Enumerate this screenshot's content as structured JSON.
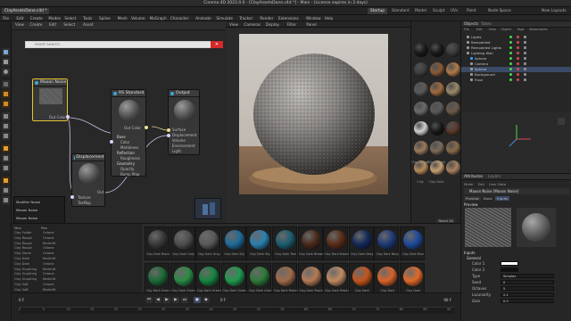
{
  "app": {
    "title": "Cinema 4D 2023.0.0 - [ClayAssetsDone.c4d *] - Main - (License expires in 3 days)"
  },
  "layout_tabs": [
    "Startup",
    "Standard",
    "Model",
    "Sculpt",
    "UVs",
    "Paint",
    "Node Space"
  ],
  "layout_tabs_right": "New Layouts",
  "doc_tab": "ClayAssetsDone.c4d *",
  "menubar": [
    "File",
    "Edit",
    "Create",
    "Modes",
    "Select",
    "Tools",
    "Spline",
    "Mesh",
    "Volume",
    "MoGraph",
    "Character",
    "Animate",
    "Simulate",
    "Tracker",
    "Render",
    "Extensions",
    "Window",
    "Help"
  ],
  "node_editor": {
    "menu": [
      "View",
      "Create",
      "Edit",
      "Select",
      "Asset"
    ],
    "search_placeholder": "Asset Search...",
    "nodes": {
      "maxon_noise": {
        "title": "Maxon Noise",
        "port": "Out Color"
      },
      "rs_standard": {
        "title": "RS Standard",
        "port": "Out Color",
        "groups": [
          {
            "name": "Base",
            "items": [
              "Color",
              "Metalness"
            ]
          },
          {
            "name": "Reflection",
            "items": [
              "Roughness"
            ]
          },
          {
            "name": "Geometry",
            "items": [
              "Opacity",
              "Bump Map"
            ]
          }
        ]
      },
      "output": {
        "title": "Output",
        "ports": [
          "Surface",
          "Displacement",
          "Volume",
          "Environment",
          "Light"
        ]
      },
      "displacement": {
        "title": "Displacement",
        "ports": [
          "Texture",
          "TexMap"
        ],
        "out": "Out"
      }
    }
  },
  "popup_menu": {
    "items": [
      "Modifier Noise",
      "Maxon Noise",
      "Maxon Noise"
    ]
  },
  "viewport": {
    "menu": [
      "View",
      "Cameras",
      "Display",
      "Filter",
      "Panel"
    ]
  },
  "material_panel": {
    "labels": [
      "Clay Rough",
      "Clay Rough",
      "Clay",
      "Clay Dark"
    ]
  },
  "objects": {
    "tabs": [
      "Objects",
      "Takes"
    ],
    "menu": [
      "File",
      "Edit",
      "View",
      "Object",
      "Tags",
      "Bookmarks"
    ],
    "rows": [
      {
        "name": "Lights",
        "color": "#9a9a9a"
      },
      {
        "name": "Remodeled",
        "color": "#9a9a9a"
      },
      {
        "name": "Remodeled Lights",
        "color": "#9a9a9a"
      },
      {
        "name": "Lighting Wall",
        "color": "#9a9a9a"
      },
      {
        "name": "Sphere",
        "color": "#2f9cff"
      },
      {
        "name": "Camera",
        "color": "#9a9a9a"
      },
      {
        "name": "Sphere",
        "color": "#9a9a9a",
        "selected": true
      },
      {
        "name": "Background",
        "color": "#9a9a9a"
      },
      {
        "name": "Floor",
        "color": "#9a9a9a"
      }
    ]
  },
  "attributes": {
    "tabs": [
      "Attributes",
      "Layers"
    ],
    "menu": [
      "Mode",
      "Edit",
      "User Data"
    ],
    "node_name": "Maxon Noise [Maxon Noise]",
    "subtabs": [
      "Preview",
      "Basic",
      "Inputs"
    ],
    "preview_label": "Preview",
    "inputs_label": "Inputs",
    "general_label": "General",
    "fields": [
      {
        "label": "Color 1",
        "value": ""
      },
      {
        "label": "Color 2",
        "value": ""
      },
      {
        "label": "Type",
        "value": "Simplex"
      },
      {
        "label": "Seed",
        "value": "0"
      },
      {
        "label": "Octaves",
        "value": "5"
      },
      {
        "label": "Lacunarity",
        "value": "2.1"
      },
      {
        "label": "Gain",
        "value": "0.5"
      }
    ]
  },
  "asset_browser": {
    "refresh_label": "Reset All",
    "row1": [
      {
        "label": "Clay Dark Black",
        "color": "#3a3a3a"
      },
      {
        "label": "Clay Dark Gray",
        "color": "#4e4e4e"
      },
      {
        "label": "Clay Dark Gray",
        "color": "#5a5a5a"
      },
      {
        "label": "Clay Dark Sky",
        "color": "#1f6b9a"
      },
      {
        "label": "Clay Dark Sky",
        "color": "#2a80b0"
      },
      {
        "label": "Clay Dark Teal",
        "color": "#1c5d70"
      },
      {
        "label": "Clay Dark Brown",
        "color": "#4a2a1c"
      },
      {
        "label": "Clay Dark Brown",
        "color": "#5a2d18"
      },
      {
        "label": "Clay Dark Navy",
        "color": "#142a5a"
      },
      {
        "label": "Clay Dark Navy",
        "color": "#1d3a78"
      },
      {
        "label": "Clay Dark Blue",
        "color": "#1e4a9a"
      }
    ],
    "row2": [
      {
        "label": "Clay Dark Green",
        "color": "#1c6a36"
      },
      {
        "label": "Clay Dark Green",
        "color": "#2a8a45"
      },
      {
        "label": "Clay Dark Green",
        "color": "#168540"
      },
      {
        "label": "Clay Dark Green",
        "color": "#1f9a4e"
      },
      {
        "label": "Clay Dark Lime",
        "color": "#2e7a38"
      },
      {
        "label": "Clay Dark Peach",
        "color": "#a06a4a"
      },
      {
        "label": "Clay Dark Peach",
        "color": "#b57a55"
      },
      {
        "label": "Clay Dark Peach",
        "color": "#c08a62"
      },
      {
        "label": "Clay Dark Orange",
        "color": "#c4551e"
      },
      {
        "label": "Clay Dark Orange",
        "color": "#d8642a"
      },
      {
        "label": "Clay Dark Orange",
        "color": "#e06a2a"
      }
    ]
  },
  "bottom_left": {
    "header": [
      "Max",
      "Rev"
    ],
    "rows": [
      [
        "Clay Folder",
        "Octane"
      ],
      [
        "Clay Rough",
        "Octane"
      ],
      [
        "Clay Rough",
        "Redshift"
      ],
      [
        "Clay Rough",
        "Octane"
      ],
      [
        "Clay Stone",
        "Octane"
      ],
      [
        "Clay Dark",
        "Redshift"
      ],
      [
        "Clay Dark",
        "Octane"
      ],
      [
        "Clay Scuplting",
        "Redshift"
      ],
      [
        "Clay Scuplting",
        "Octane"
      ],
      [
        "Clay Scuplting",
        "Redshift"
      ],
      [
        "Clay Soft",
        "Octane"
      ],
      [
        "Clay Soft",
        "Redshift"
      ]
    ]
  },
  "timeline": {
    "start": "0 F",
    "end": "90 F",
    "current": "0 F",
    "ticks": [
      "0",
      "5",
      "10",
      "15",
      "20",
      "25",
      "30",
      "35",
      "40",
      "45",
      "50",
      "55",
      "60",
      "65",
      "70",
      "75",
      "80",
      "85",
      "90"
    ]
  }
}
